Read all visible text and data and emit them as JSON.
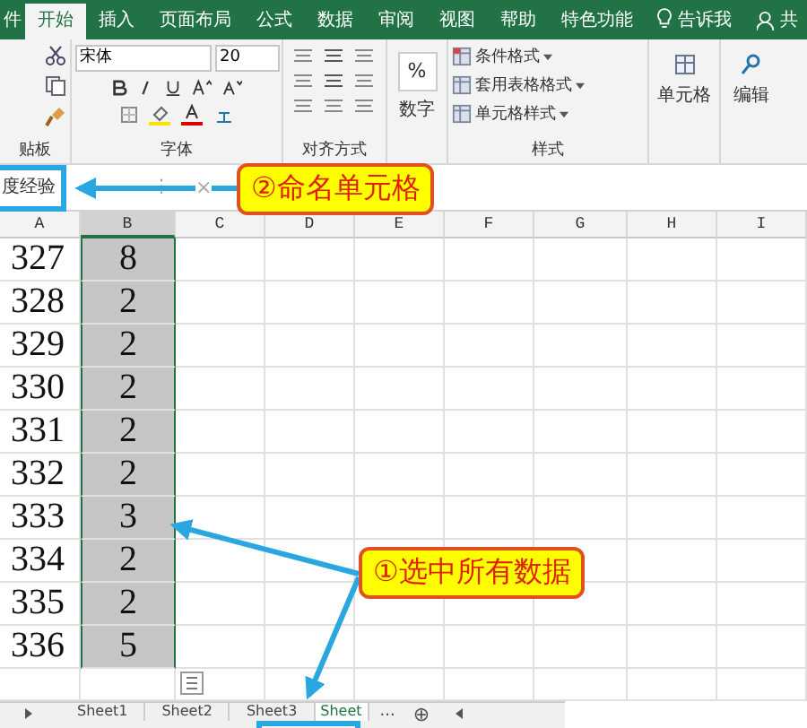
{
  "ribbon_tabs": [
    {
      "label": "件",
      "selected": false
    },
    {
      "label": "开始",
      "selected": true
    },
    {
      "label": "插入",
      "selected": false
    },
    {
      "label": "页面布局",
      "selected": false
    },
    {
      "label": "公式",
      "selected": false
    },
    {
      "label": "数据",
      "selected": false
    },
    {
      "label": "审阅",
      "selected": false
    },
    {
      "label": "视图",
      "selected": false
    },
    {
      "label": "帮助",
      "selected": false
    },
    {
      "label": "特色功能",
      "selected": false
    }
  ],
  "tell_me": "告诉我",
  "share": "共",
  "ribbon": {
    "clipboard_label": "贴板",
    "font": {
      "name": "宋体",
      "size": "20",
      "label": "字体"
    },
    "alignment_label": "对齐方式",
    "number": {
      "icon": "%",
      "label": "数字"
    },
    "styles": {
      "items": [
        "条件格式",
        "套用表格格式",
        "单元格样式"
      ],
      "label": "样式"
    },
    "cells_label": "单元格",
    "editing_label": "编辑"
  },
  "formula_bar": {
    "name_box": "度经验",
    "cancel": "×",
    "more": "⋮"
  },
  "columns": [
    {
      "label": "A",
      "selected": false
    },
    {
      "label": "B",
      "selected": true
    },
    {
      "label": "C",
      "selected": false
    },
    {
      "label": "D",
      "selected": false
    },
    {
      "label": "E",
      "selected": false
    },
    {
      "label": "F",
      "selected": false
    },
    {
      "label": "G",
      "selected": false
    },
    {
      "label": "H",
      "selected": false
    },
    {
      "label": "I",
      "selected": false
    }
  ],
  "rows": [
    {
      "a": "327",
      "b": "8"
    },
    {
      "a": "328",
      "b": "2"
    },
    {
      "a": "329",
      "b": "2"
    },
    {
      "a": "330",
      "b": "2"
    },
    {
      "a": "331",
      "b": "2"
    },
    {
      "a": "332",
      "b": "2"
    },
    {
      "a": "333",
      "b": "3"
    },
    {
      "a": "334",
      "b": "2"
    },
    {
      "a": "335",
      "b": "2"
    },
    {
      "a": "336",
      "b": "5"
    }
  ],
  "sheet_tabs": [
    {
      "label": "Sheet1",
      "selected": false
    },
    {
      "label": "Sheet2",
      "selected": false
    },
    {
      "label": "Sheet3",
      "selected": false
    },
    {
      "label": "Sheet",
      "selected": true
    }
  ],
  "sheet_more": "...",
  "add_sheet": "⊕",
  "callouts": [
    {
      "text": "②命名单元格"
    },
    {
      "text": "①选中所有数据"
    }
  ]
}
